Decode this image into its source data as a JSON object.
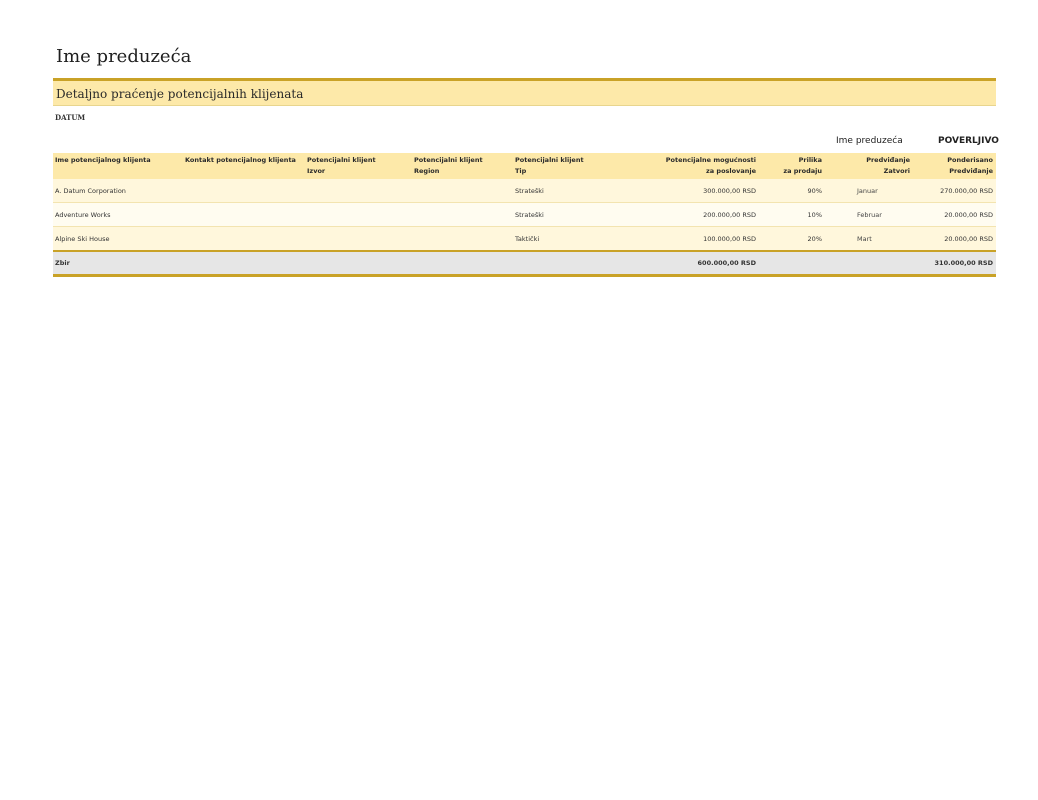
{
  "document": {
    "company_name": "Ime preduzeća",
    "subtitle": "Detaljno praćenje potencijalnih klijenata",
    "date_label": "DATUM",
    "meta_company": "Ime preduzeća",
    "meta_confidential": "POVERLJIVO"
  },
  "table": {
    "headers": [
      {
        "line1": "Ime potencijalnog klijenta",
        "line2": ""
      },
      {
        "line1": "Kontakt potencijalnog klijenta",
        "line2": ""
      },
      {
        "line1": "Potencijalni klijent",
        "line2": "Izvor"
      },
      {
        "line1": "Potencijalni klijent",
        "line2": "Region"
      },
      {
        "line1": "Potencijalni klijent",
        "line2": "Tip"
      },
      {
        "line1": "Potencijalne mogućnosti",
        "line2": "za poslovanje"
      },
      {
        "line1": "Prilika",
        "line2": "za prodaju"
      },
      {
        "line1": "Predviđanje",
        "line2": "Zatvori"
      },
      {
        "line1": "Ponderisano",
        "line2": "Predviđanje"
      }
    ],
    "rows": [
      {
        "name": "A. Datum Corporation",
        "contact": "",
        "source": "",
        "region": "",
        "type": "Strateški",
        "opportunity": "300.000,00 RSD",
        "probability": "90%",
        "close": "Januar",
        "weighted": "270.000,00 RSD"
      },
      {
        "name": "Adventure Works",
        "contact": "",
        "source": "",
        "region": "",
        "type": "Strateški",
        "opportunity": "200.000,00 RSD",
        "probability": "10%",
        "close": "Februar",
        "weighted": "20.000,00 RSD"
      },
      {
        "name": "Alpine Ski House",
        "contact": "",
        "source": "",
        "region": "",
        "type": "Taktički",
        "opportunity": "100.000,00 RSD",
        "probability": "20%",
        "close": "Mart",
        "weighted": "20.000,00 RSD"
      }
    ],
    "total": {
      "label": "Zbir",
      "opportunity": "600.000,00 RSD",
      "weighted": "310.000,00 RSD"
    }
  }
}
